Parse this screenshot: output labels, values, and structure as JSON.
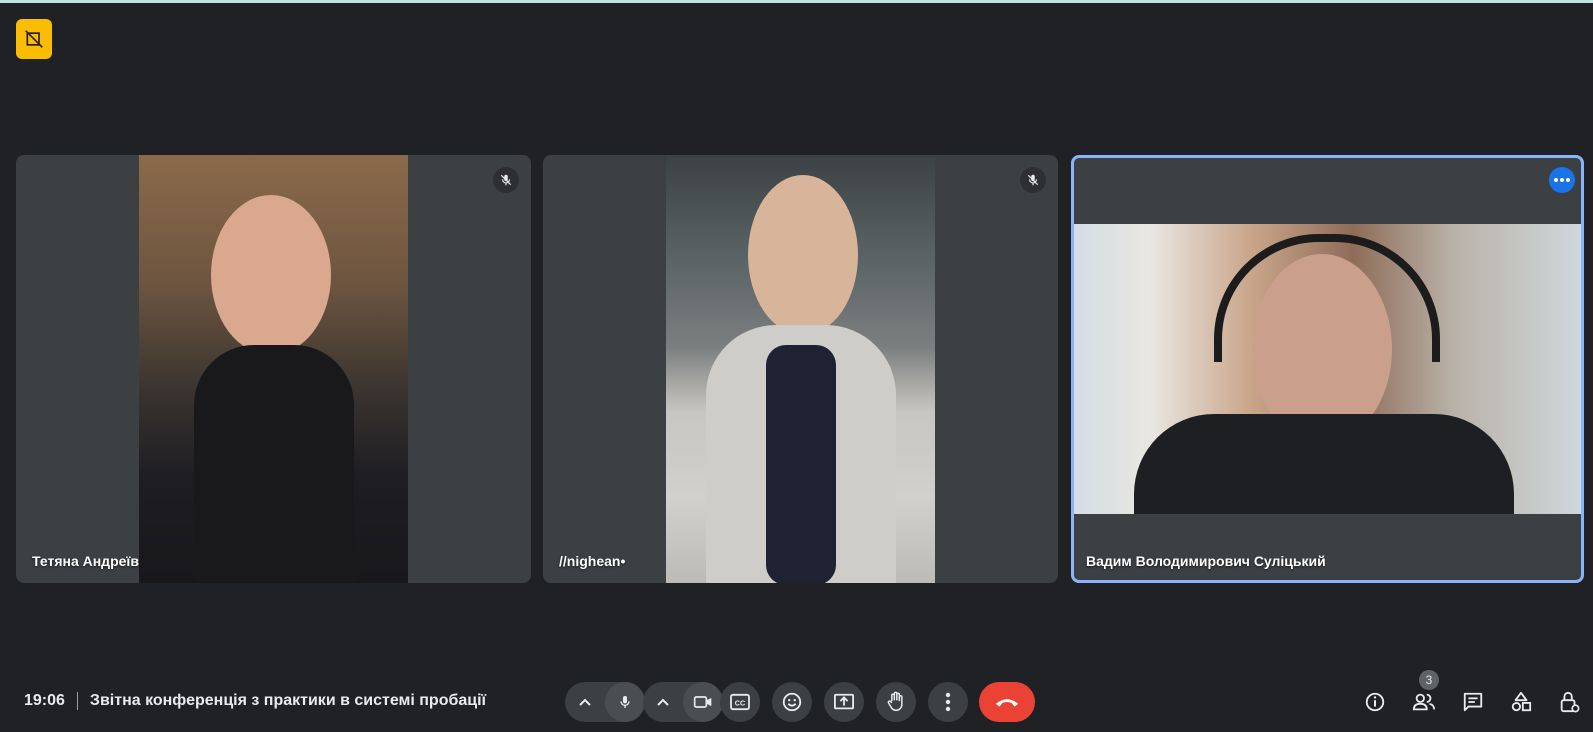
{
  "meeting": {
    "time": "19:06",
    "title": "Звітна конференція з практики в системі пробації",
    "participant_count": "3"
  },
  "participants": [
    {
      "name": "Тетяна Андреїв",
      "muted": true
    },
    {
      "name": "//nighean•",
      "muted": true
    },
    {
      "name": "Вадим Володимирович Суліцький",
      "muted": false,
      "active_speaker": true
    }
  ],
  "controls": [
    {
      "icon": "mic-icon",
      "options_icon": "chevron-up-icon"
    },
    {
      "icon": "camera-icon",
      "options_icon": "chevron-up-icon"
    },
    {
      "icon": "captions-icon"
    },
    {
      "icon": "emoji-icon"
    },
    {
      "icon": "present-screen-icon"
    },
    {
      "icon": "raise-hand-icon"
    },
    {
      "icon": "more-options-icon"
    },
    {
      "icon": "end-call-icon"
    }
  ],
  "right_controls": [
    "info-icon",
    "people-icon",
    "chat-icon",
    "activities-icon",
    "host-controls-icon"
  ],
  "colors": {
    "background": "#202124",
    "tile": "#3c4043",
    "accent": "#8ab4f8",
    "end_call": "#ea4335",
    "badge": "#fbbc04"
  }
}
